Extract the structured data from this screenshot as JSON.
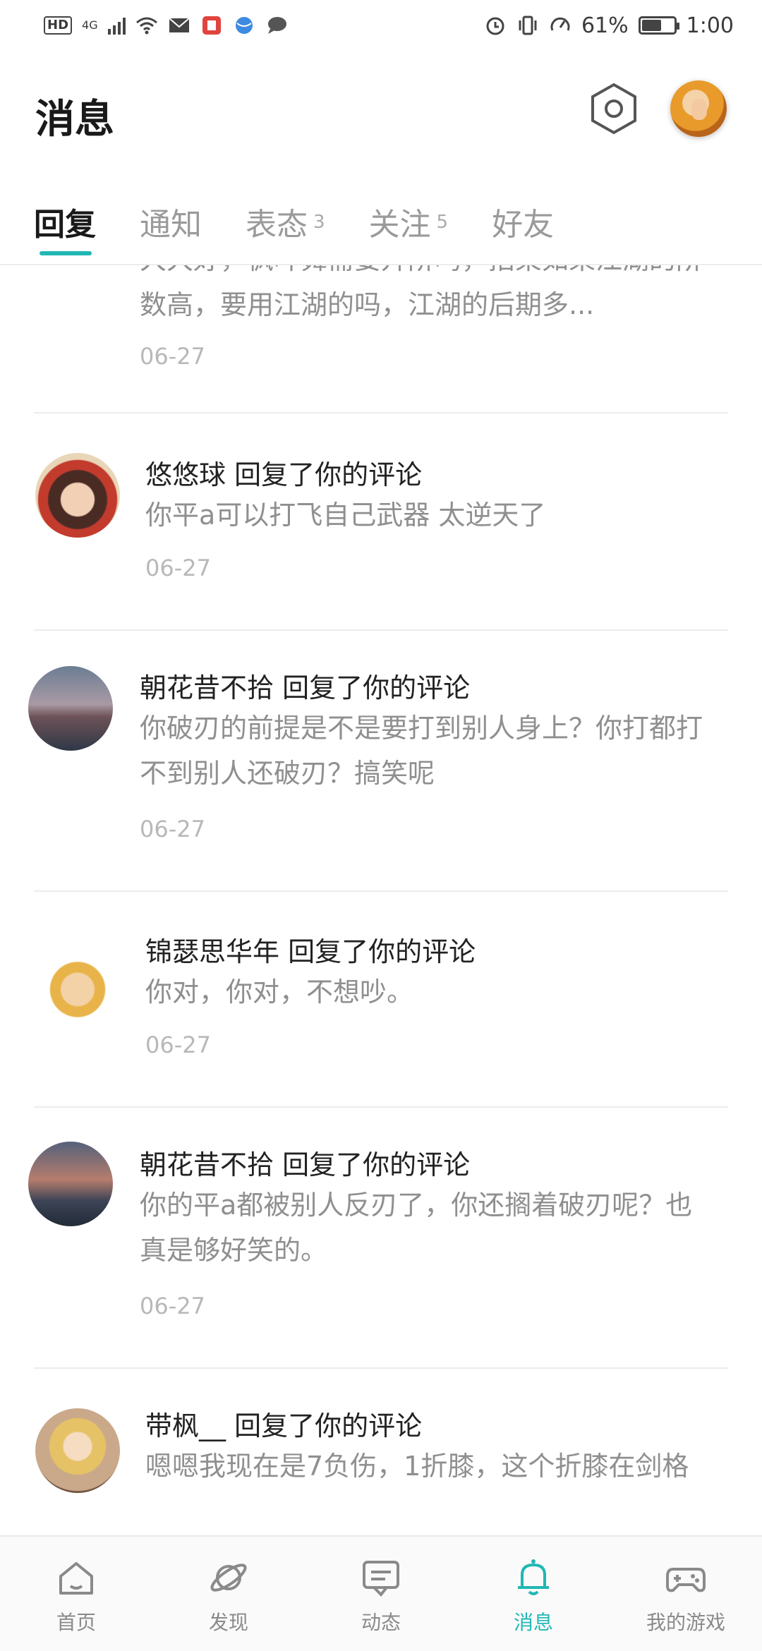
{
  "status_bar": {
    "hd": "HD",
    "network": "4G",
    "battery_percent": "61%",
    "battery_level": 0.61,
    "time": "1:00"
  },
  "header": {
    "title": "消息"
  },
  "tabs": [
    {
      "label": "回复",
      "count": "",
      "active": true
    },
    {
      "label": "通知",
      "count": "",
      "active": false
    },
    {
      "label": "表态",
      "count": "3",
      "active": false
    },
    {
      "label": "关注",
      "count": "5",
      "active": false
    },
    {
      "label": "好友",
      "count": "",
      "active": false
    }
  ],
  "messages": [
    {
      "title": "",
      "content": "大大好，枫叶舞需要升阶吗，招架如果江湖的阶数高，要用江湖的吗，江湖的后期多...",
      "date": "06-27"
    },
    {
      "title": "悠悠球 回复了你的评论",
      "content": "你平a可以打飞自己武器 太逆天了",
      "date": "06-27"
    },
    {
      "title": "朝花昔不拾 回复了你的评论",
      "content": "你破刃的前提是不是要打到别人身上？你打都打不到别人还破刃？搞笑呢",
      "date": "06-27"
    },
    {
      "title": "锦瑟思华年 回复了你的评论",
      "content": "你对，你对，不想吵。",
      "date": "06-27"
    },
    {
      "title": "朝花昔不拾 回复了你的评论",
      "content": "你的平a都被别人反刃了，你还搁着破刃呢？也真是够好笑的。",
      "date": "06-27"
    },
    {
      "title": "带枫__ 回复了你的评论",
      "content": "嗯嗯我现在是7负伤，1折膝，这个折膝在剑格",
      "date": ""
    }
  ],
  "bottom_nav": [
    {
      "label": "首页",
      "icon": "home-icon",
      "active": false
    },
    {
      "label": "发现",
      "icon": "planet-icon",
      "active": false
    },
    {
      "label": "动态",
      "icon": "chat-card-icon",
      "active": false
    },
    {
      "label": "消息",
      "icon": "bell-icon",
      "active": true
    },
    {
      "label": "我的游戏",
      "icon": "gamepad-icon",
      "active": false
    }
  ],
  "colors": {
    "accent": "#21b7b5",
    "muted_text": "#8f8f8f",
    "date_text": "#b8b8b8"
  }
}
